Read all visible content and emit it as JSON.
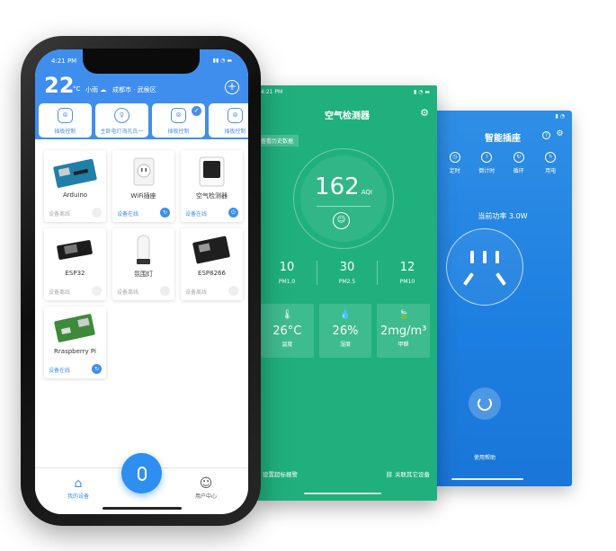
{
  "plug": {
    "status_icons": "▮ ◔",
    "title": "智能插座",
    "help_icon": "?",
    "settings_icon": "⚙",
    "modes": [
      {
        "label": "定时",
        "icon": "clock-icon"
      },
      {
        "label": "倒计时",
        "icon": "countdown-icon"
      },
      {
        "label": "循环",
        "icon": "loop-icon"
      },
      {
        "label": "用电",
        "icon": "power-usage-icon"
      }
    ],
    "power_text": "当前功率 3.0W",
    "help_text": "使用帮助"
  },
  "air": {
    "time": "4:21 PM",
    "status_icons": "▮ ◔ ▬",
    "title": "空气检测器",
    "history_label": "查看历史数据",
    "aqi_value": "162",
    "aqi_unit": "AQI",
    "face_icon": "☺",
    "pms": [
      {
        "value": "10",
        "label": "PM1.0"
      },
      {
        "value": "30",
        "label": "PM2.5"
      },
      {
        "value": "12",
        "label": "PM10"
      }
    ],
    "cards": [
      {
        "icon": "🌡",
        "value": "26°C",
        "label": "温度"
      },
      {
        "icon": "💧",
        "value": "26%",
        "label": "湿度"
      },
      {
        "icon": "🍃",
        "value": "2mg/m³",
        "label": "甲醛"
      }
    ],
    "alarm_label": "设置超标报警",
    "link_label": "关联其它设备"
  },
  "main": {
    "time": "4:21 PM",
    "status_icons": "▮▮ ◔ ▬",
    "temperature": "22",
    "temp_unit": "°C",
    "weather": "小雨",
    "location": "成都市 · 武侯区",
    "quick_actions": [
      {
        "label": "插板控制",
        "checked": false
      },
      {
        "label": "主卧电灯海孔氏一",
        "checked": false
      },
      {
        "label": "插板控制",
        "checked": true
      },
      {
        "label": "插板控制",
        "checked": false
      }
    ],
    "devices": [
      {
        "name": "Arduino",
        "status": "设备离线",
        "online": false
      },
      {
        "name": "WiFi插座",
        "status": "设备在线",
        "online": true
      },
      {
        "name": "空气检测器",
        "status": "设备在线",
        "online": true
      },
      {
        "name": "ESP32",
        "status": "设备离线",
        "online": false
      },
      {
        "name": "氛围灯",
        "status": "设备离线",
        "online": false
      },
      {
        "name": "ESP8266",
        "status": "设备离线",
        "online": false
      },
      {
        "name": "Rraspberry Pi",
        "status": "设备在线",
        "online": true
      }
    ],
    "tabs": [
      {
        "label": "我的设备",
        "icon": "home-icon"
      },
      {
        "label": "用户中心",
        "icon": "user-icon"
      }
    ]
  },
  "colors": {
    "primary": "#3f8eee",
    "air_green": "#20b07e",
    "plug_blue": "#2f8fe6"
  }
}
